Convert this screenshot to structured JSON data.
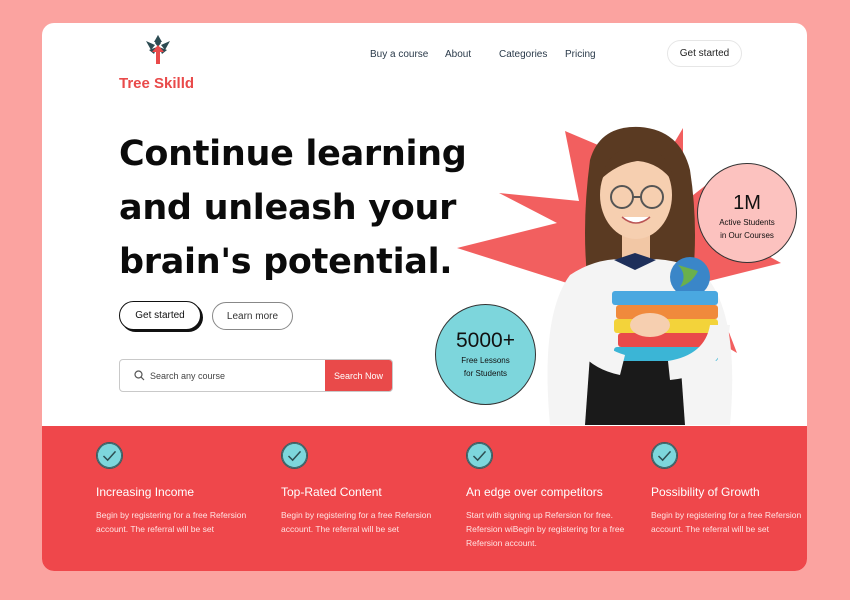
{
  "brand": {
    "name": "Tree Skilld"
  },
  "nav": {
    "items": [
      "Buy a course",
      "About",
      "Categories",
      "Pricing"
    ],
    "cta": "Get started"
  },
  "hero": {
    "title_line1": "Continue learning",
    "title_line2": "and unleash your",
    "title_line3": "brain's potential.",
    "primary_button": "Get started",
    "secondary_button": "Learn more"
  },
  "search": {
    "placeholder": "Search any course",
    "button": "Search Now"
  },
  "stats": {
    "students": {
      "value": "1M",
      "label_line1": "Active Students",
      "label_line2": "in Our Courses"
    },
    "lessons": {
      "value": "5000+",
      "label_line1": "Free Lessons",
      "label_line2": "for Students"
    }
  },
  "features": [
    {
      "title": "Increasing Income",
      "desc": "Begin by registering for a free Refersion account. The referral will be set"
    },
    {
      "title": "Top-Rated Content",
      "desc": "Begin by registering for a free Refersion account. The referral will be set"
    },
    {
      "title": "An edge over competitors",
      "desc": "Start with signing up Refersion for free. Refersion wiBegin by registering for a free Refersion account."
    },
    {
      "title": "Possibility of Growth",
      "desc": "Begin by registering for a free Refersion account. The referral will be set"
    }
  ],
  "colors": {
    "brand": "#e94a4a",
    "accent": "#7dd6dc",
    "page_bg": "#fba3a0",
    "pink_circle": "#fcc2bf"
  },
  "icons": {
    "logo": "tree-logo-icon",
    "search": "search-icon",
    "check": "check-icon"
  }
}
